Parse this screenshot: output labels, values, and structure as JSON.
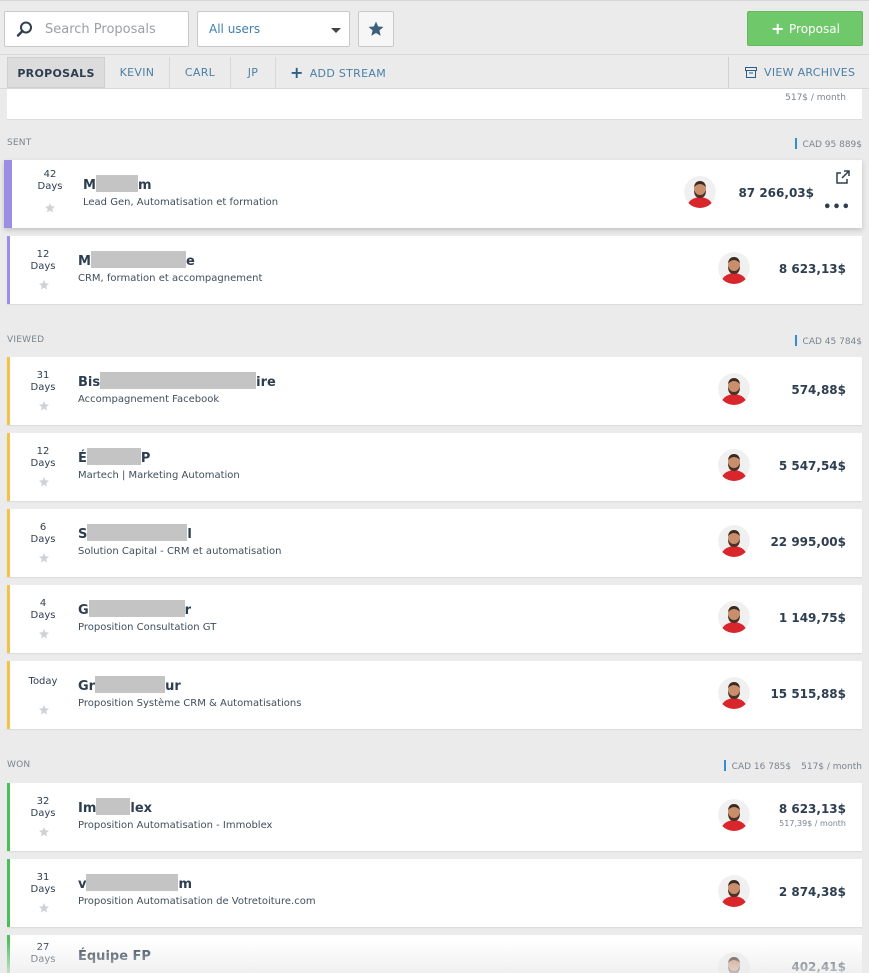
{
  "toolbar": {
    "search_placeholder": "Search Proposals",
    "user_filter": "All users",
    "new_proposal_label": "Proposal",
    "new_proposal_color": "#6fc96b"
  },
  "tabs": {
    "items": [
      "PROPOSALS",
      "KEVIN",
      "CARL",
      "JP"
    ],
    "add_stream": "ADD STREAM",
    "view_archives": "VIEW ARCHIVES"
  },
  "top_partial": {
    "monthly": "517$ / month"
  },
  "stages": [
    {
      "label": "SENT",
      "total": "CAD 95 889$",
      "color": "#9c8ee4"
    },
    {
      "label": "VIEWED",
      "total": "CAD 45 784$",
      "color": "#f3c24a"
    },
    {
      "label": "WON",
      "total": "CAD 16 785$",
      "monthly": "517$ / month",
      "color": "#4cbf5b"
    }
  ],
  "proposals": [
    {
      "days": "42",
      "unit": "Days",
      "title_start": "M",
      "title_end": "m",
      "subtitle": "Lead Gen, Automatisation et formation",
      "amount": "87 266,03$"
    },
    {
      "days": "12",
      "unit": "Days",
      "title_start": "M",
      "title_end": "e",
      "subtitle": "CRM, formation et accompagnement",
      "amount": "8 623,13$"
    },
    {
      "days": "31",
      "unit": "Days",
      "title_start": "Bis",
      "title_end": "ire",
      "subtitle": "Accompagnement Facebook",
      "amount": "574,88$"
    },
    {
      "days": "12",
      "unit": "Days",
      "title_start": "É",
      "title_end": "P",
      "subtitle": "Martech | Marketing Automation",
      "amount": "5 547,54$"
    },
    {
      "days": "6",
      "unit": "Days",
      "title_start": "S",
      "title_end": "l",
      "subtitle": "Solution Capital - CRM et automatisation",
      "amount": "22 995,00$"
    },
    {
      "days": "4",
      "unit": "Days",
      "title_start": "G",
      "title_end": "r",
      "subtitle": "Proposition Consultation GT",
      "amount": "1 149,75$"
    },
    {
      "days": "Today",
      "title_start": "Gr",
      "title_end": "ur",
      "subtitle": "Proposition Système CRM & Automatisations",
      "amount": "15 515,88$"
    },
    {
      "days": "32",
      "unit": "Days",
      "title_start": "Im",
      "title_end": "lex",
      "subtitle": "Proposition Automatisation - Immoblex",
      "amount": "8 623,13$",
      "monthly": "517,39$ / month"
    },
    {
      "days": "31",
      "unit": "Days",
      "title_start": "v",
      "title_end": "m",
      "subtitle": "Proposition Automatisation de Votretoiture.com",
      "amount": "2 874,38$"
    },
    {
      "days": "27",
      "unit": "Days",
      "title_start": "Équipe FP",
      "title_end": "",
      "subtitle": "",
      "amount": "402,41$"
    }
  ]
}
